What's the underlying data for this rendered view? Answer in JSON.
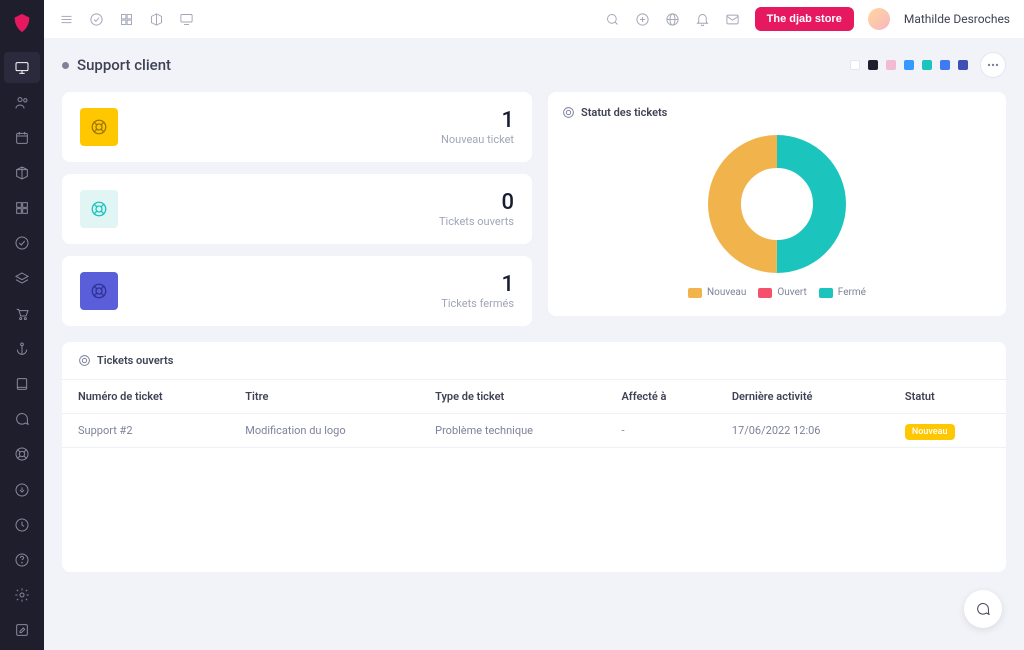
{
  "header": {
    "store_button": "The djab store",
    "user_name": "Mathilde Desroches"
  },
  "page": {
    "title": "Support client"
  },
  "color_swatches": [
    "#ffffff",
    "#1e1e2d",
    "#f1bbd5",
    "#3699ff",
    "#1bc5bd",
    "#3699ff",
    "#3e50b4"
  ],
  "stats": [
    {
      "value": "1",
      "label": "Nouveau ticket",
      "bg": "#ffc700",
      "icon": "#a07800"
    },
    {
      "value": "0",
      "label": "Tickets ouverts",
      "bg": "#e1f6f4",
      "icon": "#1bc5bd"
    },
    {
      "value": "1",
      "label": "Tickets fermés",
      "bg": "#5a5ed8",
      "icon": "#2f3396"
    }
  ],
  "chart_card_title": "Statut des tickets",
  "chart_data": {
    "type": "pie",
    "title": "Statut des tickets",
    "series": [
      {
        "name": "Nouveau",
        "value": 1,
        "color": "#f1b44c"
      },
      {
        "name": "Ouvert",
        "value": 0,
        "color": "#f4516c"
      },
      {
        "name": "Fermé",
        "value": 1,
        "color": "#1bc5bd"
      }
    ]
  },
  "open_tickets_title": "Tickets ouverts",
  "table": {
    "columns": [
      "Numéro de ticket",
      "Titre",
      "Type de ticket",
      "Affecté à",
      "Dernière activité",
      "Statut"
    ],
    "rows": [
      {
        "num": "Support #2",
        "title": "Modification du logo",
        "type": "Problème technique",
        "assigned": "-",
        "activity": "17/06/2022 12:06",
        "status": "Nouveau"
      }
    ]
  }
}
